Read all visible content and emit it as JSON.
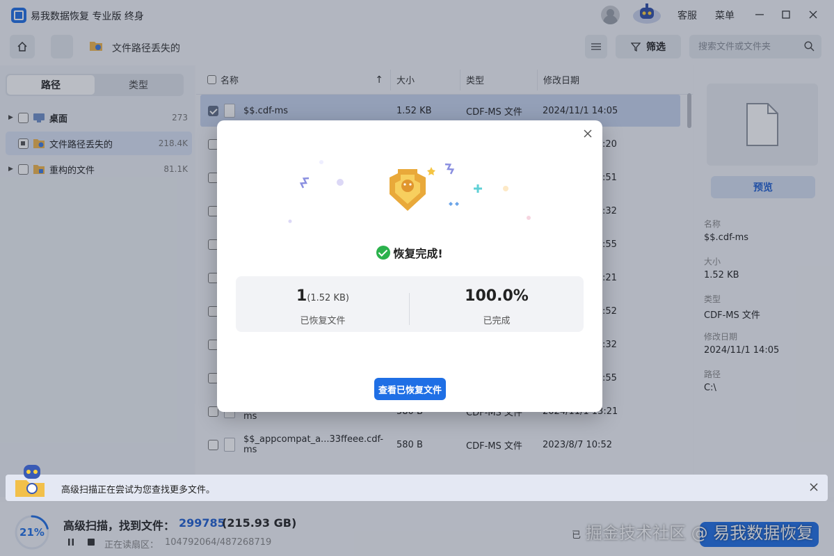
{
  "app": {
    "title": "易我数据恢复 专业版 终身",
    "service_label": "客服",
    "menu_label": "菜单"
  },
  "toolbar": {
    "breadcrumb": "文件路径丢失的",
    "filter_label": "筛选",
    "search_placeholder": "搜索文件或文件夹"
  },
  "left_panel": {
    "tabs": [
      "路径",
      "类型"
    ],
    "active_tab": "路径",
    "tree": [
      {
        "label": "桌面",
        "count": "273"
      },
      {
        "label": "文件路径丢失的",
        "count": "218.4K"
      },
      {
        "label": "重构的文件",
        "count": "81.1K"
      }
    ]
  },
  "table": {
    "headers": {
      "name": "名称",
      "size": "大小",
      "type": "类型",
      "date": "修改日期"
    },
    "rows": [
      {
        "name": "$$.cdf-ms",
        "size": "1.52 KB",
        "type": "CDF-MS 文件",
        "date": "2024/11/1 14:05",
        "date_tail": ""
      },
      {
        "name": "",
        "size": "",
        "type": "",
        "date": "",
        "date_tail": ":20"
      },
      {
        "name": "",
        "size": "",
        "type": "",
        "date": "",
        "date_tail": ":51"
      },
      {
        "name": "",
        "size": "",
        "type": "",
        "date": "",
        "date_tail": ":32"
      },
      {
        "name": "",
        "size": "",
        "type": "",
        "date": "",
        "date_tail": ":55"
      },
      {
        "name": "",
        "size": "",
        "type": "",
        "date": "",
        "date_tail": ":21"
      },
      {
        "name": "",
        "size": "",
        "type": "",
        "date": "",
        "date_tail": ":52"
      },
      {
        "name": "",
        "size": "",
        "type": "",
        "date": "",
        "date_tail": ":32"
      },
      {
        "name": "",
        "size": "",
        "type": "",
        "date": "",
        "date_tail": ":55"
      },
      {
        "name": "$$_appcompat_a...33ffeee.cdf-ms",
        "size": "580 B",
        "type": "CDF-MS 文件",
        "date": "2024/11/1 13:21",
        "date_tail": ""
      },
      {
        "name": "$$_appcompat_a...33ffeee.cdf-ms",
        "size": "580 B",
        "type": "CDF-MS 文件",
        "date": "2023/8/7 10:52",
        "date_tail": ""
      }
    ]
  },
  "preview": {
    "button": "预览",
    "fields": [
      {
        "label": "名称",
        "value": "$$.cdf-ms"
      },
      {
        "label": "大小",
        "value": "1.52 KB"
      },
      {
        "label": "类型",
        "value": "CDF-MS 文件"
      },
      {
        "label": "修改日期",
        "value": "2024/11/1 14:05"
      },
      {
        "label": "路径",
        "value": "C:\\"
      }
    ]
  },
  "notice": {
    "text": "高级扫描正在尝试为您查找更多文件。"
  },
  "status": {
    "progress_pct": "21%",
    "progress_fraction": 0.21,
    "title": "高级扫描，找到文件：",
    "count": "299785",
    "size": "(215.93 GB)",
    "reading_label": "正在读扇区：",
    "reading_value": "104792064/487268719",
    "recover_hint": "已",
    "watermark": "掘金技术社区 @ 易我数据恢复"
  },
  "modal": {
    "done_text": "恢复完成!",
    "recovered_count": "1",
    "recovered_size": "(1.52 KB)",
    "recovered_label": "已恢复文件",
    "percent": "100.0%",
    "percent_label": "已完成",
    "view_button": "查看已恢复文件"
  },
  "colors": {
    "accent": "#1f6fe5",
    "success": "#2bb24c"
  }
}
